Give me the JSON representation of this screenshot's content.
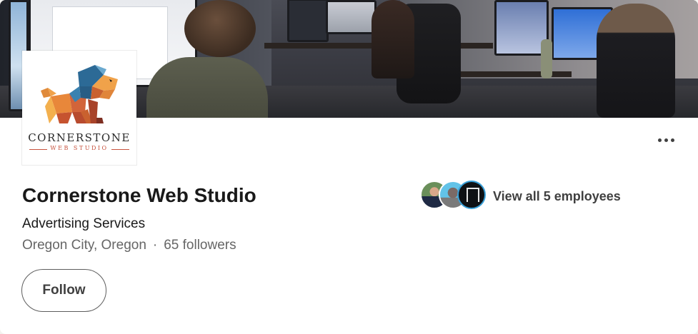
{
  "company": {
    "name": "Cornerstone Web Studio",
    "industry": "Advertising Services",
    "location": "Oregon City, Oregon",
    "separator": "·",
    "followers": "65 followers"
  },
  "logo": {
    "wordmark": "CORNERSTONE",
    "subtitle": "WEB STUDIO"
  },
  "actions": {
    "follow_label": "Follow",
    "more_icon": "ellipsis-icon"
  },
  "employees": {
    "link_label": "View all 5 employees",
    "avatar_count": 3
  },
  "colors": {
    "accent": "#c7523d",
    "text_primary": "#191919",
    "text_secondary": "#666666"
  }
}
